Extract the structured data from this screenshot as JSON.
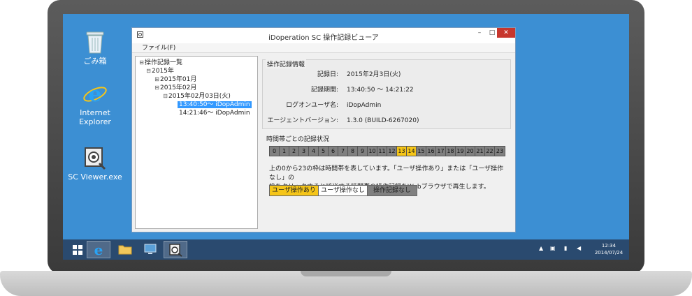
{
  "desktop": {
    "icons": [
      {
        "label": "ごみ箱"
      },
      {
        "label": "Internet\nExplorer"
      },
      {
        "label": "SC Viewer.exe"
      }
    ]
  },
  "window": {
    "title": "iDoperation SC 操作記録ビューア",
    "menu": [
      "ファイル(F)"
    ]
  },
  "tree": {
    "root": "操作記録一覧",
    "year": "2015年",
    "month1": "2015年01月",
    "month2": "2015年02月",
    "day": "2015年02月03日(火)",
    "sessions": [
      "13:40:50～ iDopAdmin",
      "14:21:46～ iDopAdmin"
    ]
  },
  "info": {
    "title": "操作記録情報",
    "rows": [
      {
        "label": "記録日:",
        "value": "2015年2月3日(火)"
      },
      {
        "label": "記録期間:",
        "value": "13:40:50 ～ 14:21:22"
      },
      {
        "label": "ログオンユーザ名:",
        "value": "iDopAdmin"
      },
      {
        "label": "エージェントバージョン:",
        "value": "1.3.0 (BUILD-6267020)"
      }
    ]
  },
  "hours_section": {
    "title": "時間帯ごとの記録状況",
    "hours": [
      "0",
      "1",
      "2",
      "3",
      "4",
      "5",
      "6",
      "7",
      "8",
      "9",
      "10",
      "11",
      "12",
      "13",
      "14",
      "15",
      "16",
      "17",
      "18",
      "19",
      "20",
      "21",
      "22",
      "23"
    ],
    "active_hours": [
      13,
      14
    ],
    "description_line1": "上の0から23の枠は時間帯を表しています。「ユーザ操作あり」または「ユーザ操作なし」の",
    "description_line2": "枠をクリックすると該当する時間帯の操作記録をWebブラウザで再生します。",
    "legend": [
      "ユーザ操作あり",
      "ユーザ操作なし",
      "操作記録なし"
    ]
  },
  "taskbar": {
    "time": "12:34",
    "date": "2014/07/24"
  },
  "colors": {
    "desktop": "#3c8fd3",
    "active_hour": "#f5c518",
    "inactive_hour": "#808080",
    "selection": "#3399ff",
    "close_button": "#c7362d"
  }
}
